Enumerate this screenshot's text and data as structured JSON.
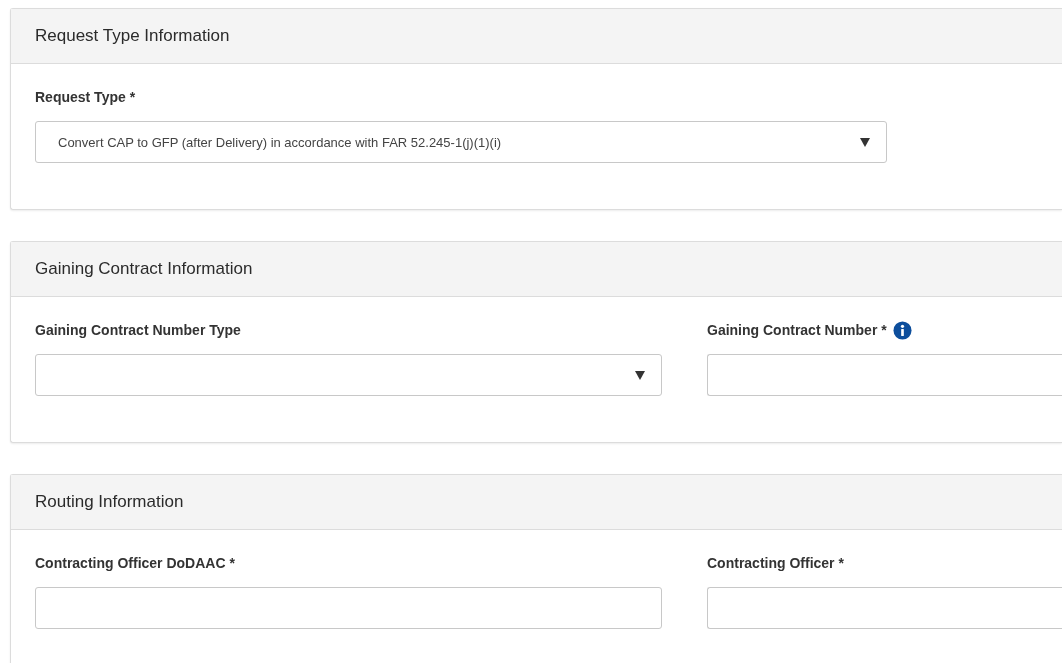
{
  "sections": [
    {
      "title": "Request Type Information",
      "fields": [
        {
          "label": "Request Type *",
          "kind": "select",
          "value": "Convert CAP to GFP (after Delivery) in accordance with FAR 52.245-1(j)(1)(i)"
        }
      ]
    },
    {
      "title": "Gaining Contract Information",
      "fields": [
        {
          "label": "Gaining Contract Number Type",
          "kind": "select"
        },
        {
          "label": "Gaining Contract Number *",
          "kind": "text",
          "info": true
        }
      ]
    },
    {
      "title": "Routing Information",
      "fields": [
        {
          "label": "Contracting Officer DoDAAC *",
          "kind": "text"
        },
        {
          "label": "Contracting Officer *",
          "kind": "text"
        }
      ]
    }
  ]
}
